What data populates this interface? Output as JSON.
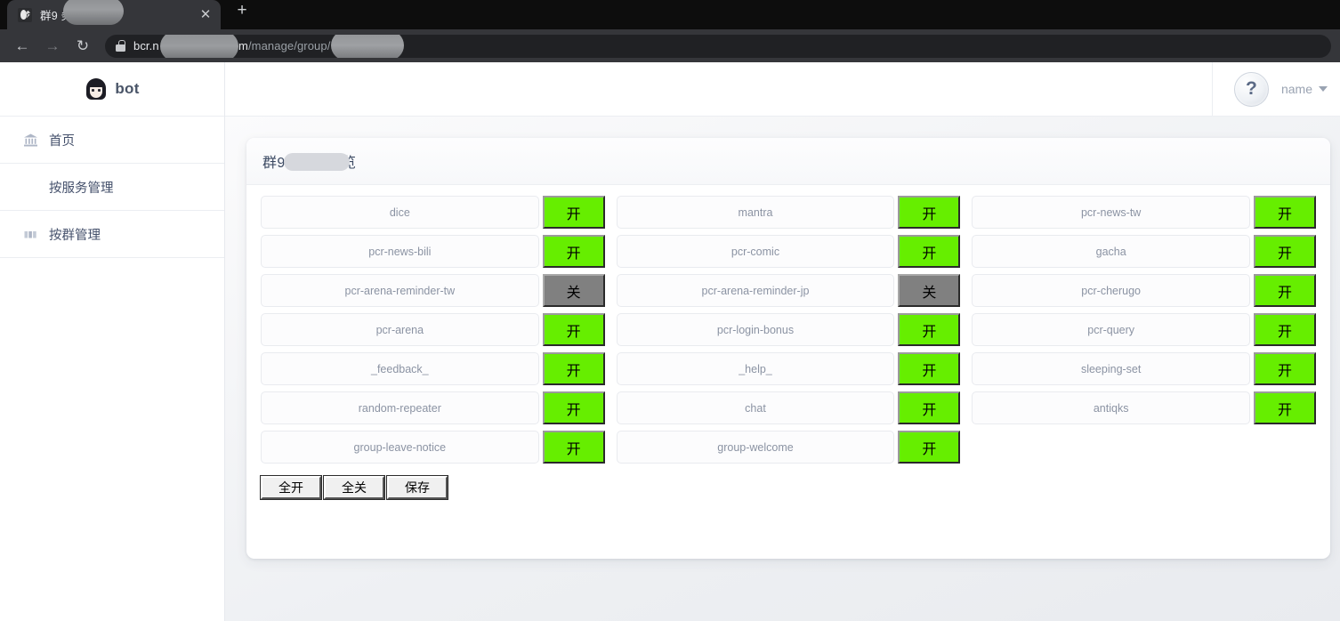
{
  "browser": {
    "tab": {
      "title": "群9         务一览",
      "close_label": "✕",
      "favicon": "bot-favicon"
    },
    "newtab_label": "+",
    "back_label": "←",
    "forward_label": "→",
    "reload_label": "↻",
    "url_host": "bcr.n",
    "url_host2": "om",
    "url_path": "/manage/group/"
  },
  "sidebar": {
    "brand": "bot",
    "items": [
      {
        "label": "首页",
        "icon": "bank-icon"
      },
      {
        "label": "按服务管理",
        "icon": "circle-icon"
      },
      {
        "label": "按群管理",
        "icon": "bars-icon"
      }
    ]
  },
  "topbar": {
    "avatar_glyph": "?",
    "username": "name"
  },
  "card": {
    "title": "群9        3服务一览",
    "services": [
      {
        "name": "dice",
        "state": "on",
        "state_label": "开"
      },
      {
        "name": "mantra",
        "state": "on",
        "state_label": "开"
      },
      {
        "name": "pcr-news-tw",
        "state": "on",
        "state_label": "开"
      },
      {
        "name": "pcr-news-bili",
        "state": "on",
        "state_label": "开"
      },
      {
        "name": "pcr-comic",
        "state": "on",
        "state_label": "开"
      },
      {
        "name": "gacha",
        "state": "on",
        "state_label": "开"
      },
      {
        "name": "pcr-arena-reminder-tw",
        "state": "off",
        "state_label": "关"
      },
      {
        "name": "pcr-arena-reminder-jp",
        "state": "off",
        "state_label": "关"
      },
      {
        "name": "pcr-cherugo",
        "state": "on",
        "state_label": "开"
      },
      {
        "name": "pcr-arena",
        "state": "on",
        "state_label": "开"
      },
      {
        "name": "pcr-login-bonus",
        "state": "on",
        "state_label": "开"
      },
      {
        "name": "pcr-query",
        "state": "on",
        "state_label": "开"
      },
      {
        "name": "_feedback_",
        "state": "on",
        "state_label": "开"
      },
      {
        "name": "_help_",
        "state": "on",
        "state_label": "开"
      },
      {
        "name": "sleeping-set",
        "state": "on",
        "state_label": "开"
      },
      {
        "name": "random-repeater",
        "state": "on",
        "state_label": "开"
      },
      {
        "name": "chat",
        "state": "on",
        "state_label": "开"
      },
      {
        "name": "antiqks",
        "state": "on",
        "state_label": "开"
      },
      {
        "name": "group-leave-notice",
        "state": "on",
        "state_label": "开"
      },
      {
        "name": "group-welcome",
        "state": "on",
        "state_label": "开"
      }
    ],
    "actions": [
      {
        "label": "全开",
        "name": "all-on-button"
      },
      {
        "label": "全关",
        "name": "all-off-button"
      },
      {
        "label": "保存",
        "name": "save-button"
      }
    ]
  },
  "colors": {
    "toggle_on": "#66ee00",
    "toggle_off": "#808080",
    "chrome_tabstrip": "#0d0d0d",
    "chrome_toolbar": "#35363a",
    "sidebar_text": "#44506b"
  }
}
